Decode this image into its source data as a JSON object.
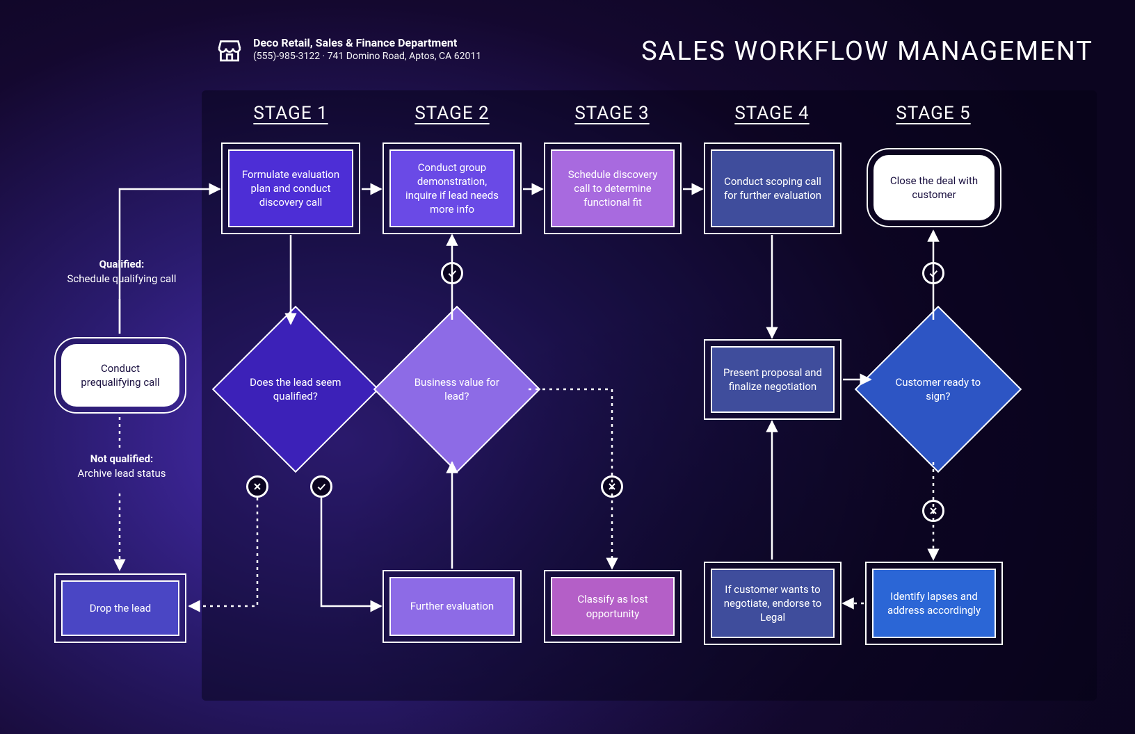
{
  "brand": {
    "name": "Deco Retail, Sales & Finance Department",
    "contact": "(555)-985-3122 · 741 Domino Road, Aptos, CA 62011"
  },
  "title": "SALES WORKFLOW MANAGEMENT",
  "stages": [
    "STAGE 1",
    "STAGE 2",
    "STAGE 3",
    "STAGE 4",
    "STAGE 5"
  ],
  "pre": {
    "qualified_head": "Qualified:",
    "qualified_body": "Schedule qualifying call",
    "prequal": "Conduct prequalifying call",
    "notqual_head": "Not qualified:",
    "notqual_body": "Archive lead status",
    "drop": "Drop the lead"
  },
  "s1": {
    "top": "Formulate evaluation plan and conduct discovery call",
    "decision": "Does the lead seem qualified?"
  },
  "s2": {
    "top": "Conduct group demonstration, inquire if lead needs more info",
    "decision": "Business value for lead?",
    "further": "Further evaluation"
  },
  "s3": {
    "top": "Schedule discovery call to determine functional fit",
    "lost": "Classify as lost opportunity"
  },
  "s4": {
    "top": "Conduct scoping call for further evaluation",
    "present": "Present proposal and finalize negotiation",
    "negotiate": "If customer wants to negotiate, endorse to Legal"
  },
  "s5": {
    "close": "Close the deal with customer",
    "decision": "Customer ready to sign?",
    "identify": "Identify lapses and address accordingly"
  }
}
